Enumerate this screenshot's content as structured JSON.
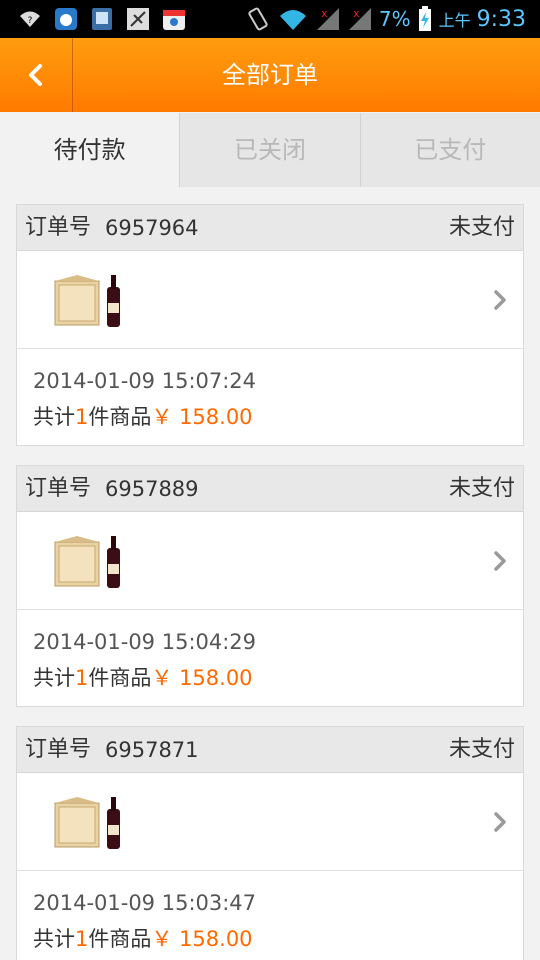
{
  "status_bar": {
    "battery_percent": "7%",
    "ampm": "上午",
    "time": "9:33"
  },
  "header": {
    "title": "全部订单"
  },
  "tabs": [
    {
      "label": "待付款",
      "active": true
    },
    {
      "label": "已关闭",
      "active": false
    },
    {
      "label": "已支付",
      "active": false
    }
  ],
  "order_no_label": "订单号",
  "orders": [
    {
      "number": "6957964",
      "status": "未支付",
      "time": "2014-01-09 15:07:24",
      "total_prefix": "共计",
      "count": "1",
      "total_mid": "件商品",
      "currency": "￥",
      "price": "158.00"
    },
    {
      "number": "6957889",
      "status": "未支付",
      "time": "2014-01-09 15:04:29",
      "total_prefix": "共计",
      "count": "1",
      "total_mid": "件商品",
      "currency": "￥",
      "price": "158.00"
    },
    {
      "number": "6957871",
      "status": "未支付",
      "time": "2014-01-09 15:03:47",
      "total_prefix": "共计",
      "count": "1",
      "total_mid": "件商品",
      "currency": "￥",
      "price": "158.00"
    }
  ],
  "colors": {
    "header_orange": "#ff8a00",
    "price_orange": "#ff6a00",
    "status_blue": "#5cc8ff"
  }
}
